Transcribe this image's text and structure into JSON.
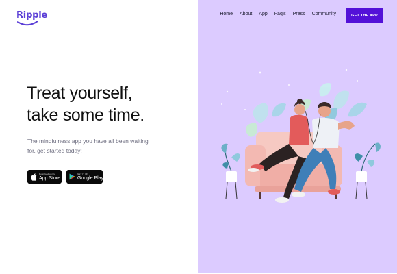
{
  "brand": {
    "name": "Ripple",
    "color": "#5b3fd6"
  },
  "nav": {
    "items": [
      {
        "label": "Home",
        "active": false
      },
      {
        "label": "About",
        "active": false
      },
      {
        "label": "App",
        "active": true
      },
      {
        "label": "Faq's",
        "active": false
      },
      {
        "label": "Press",
        "active": false
      },
      {
        "label": "Community",
        "active": false
      }
    ],
    "cta_label": "GET THE APP"
  },
  "hero": {
    "title_line1": "Treat yourself,",
    "title_line2": "take some time.",
    "subtitle": "The mindfulness app you have all been waiting for, get started today!"
  },
  "stores": {
    "apple": {
      "small": "Download on the",
      "big": "App Store",
      "icon": "apple-icon"
    },
    "google": {
      "small": "GET IT ON",
      "big": "Google Play",
      "icon": "google-play-icon"
    }
  },
  "colors": {
    "panel_bg": "#dccbff",
    "cta_bg": "#5311d8",
    "text_dark": "#111111",
    "text_muted": "#6e6e80"
  }
}
